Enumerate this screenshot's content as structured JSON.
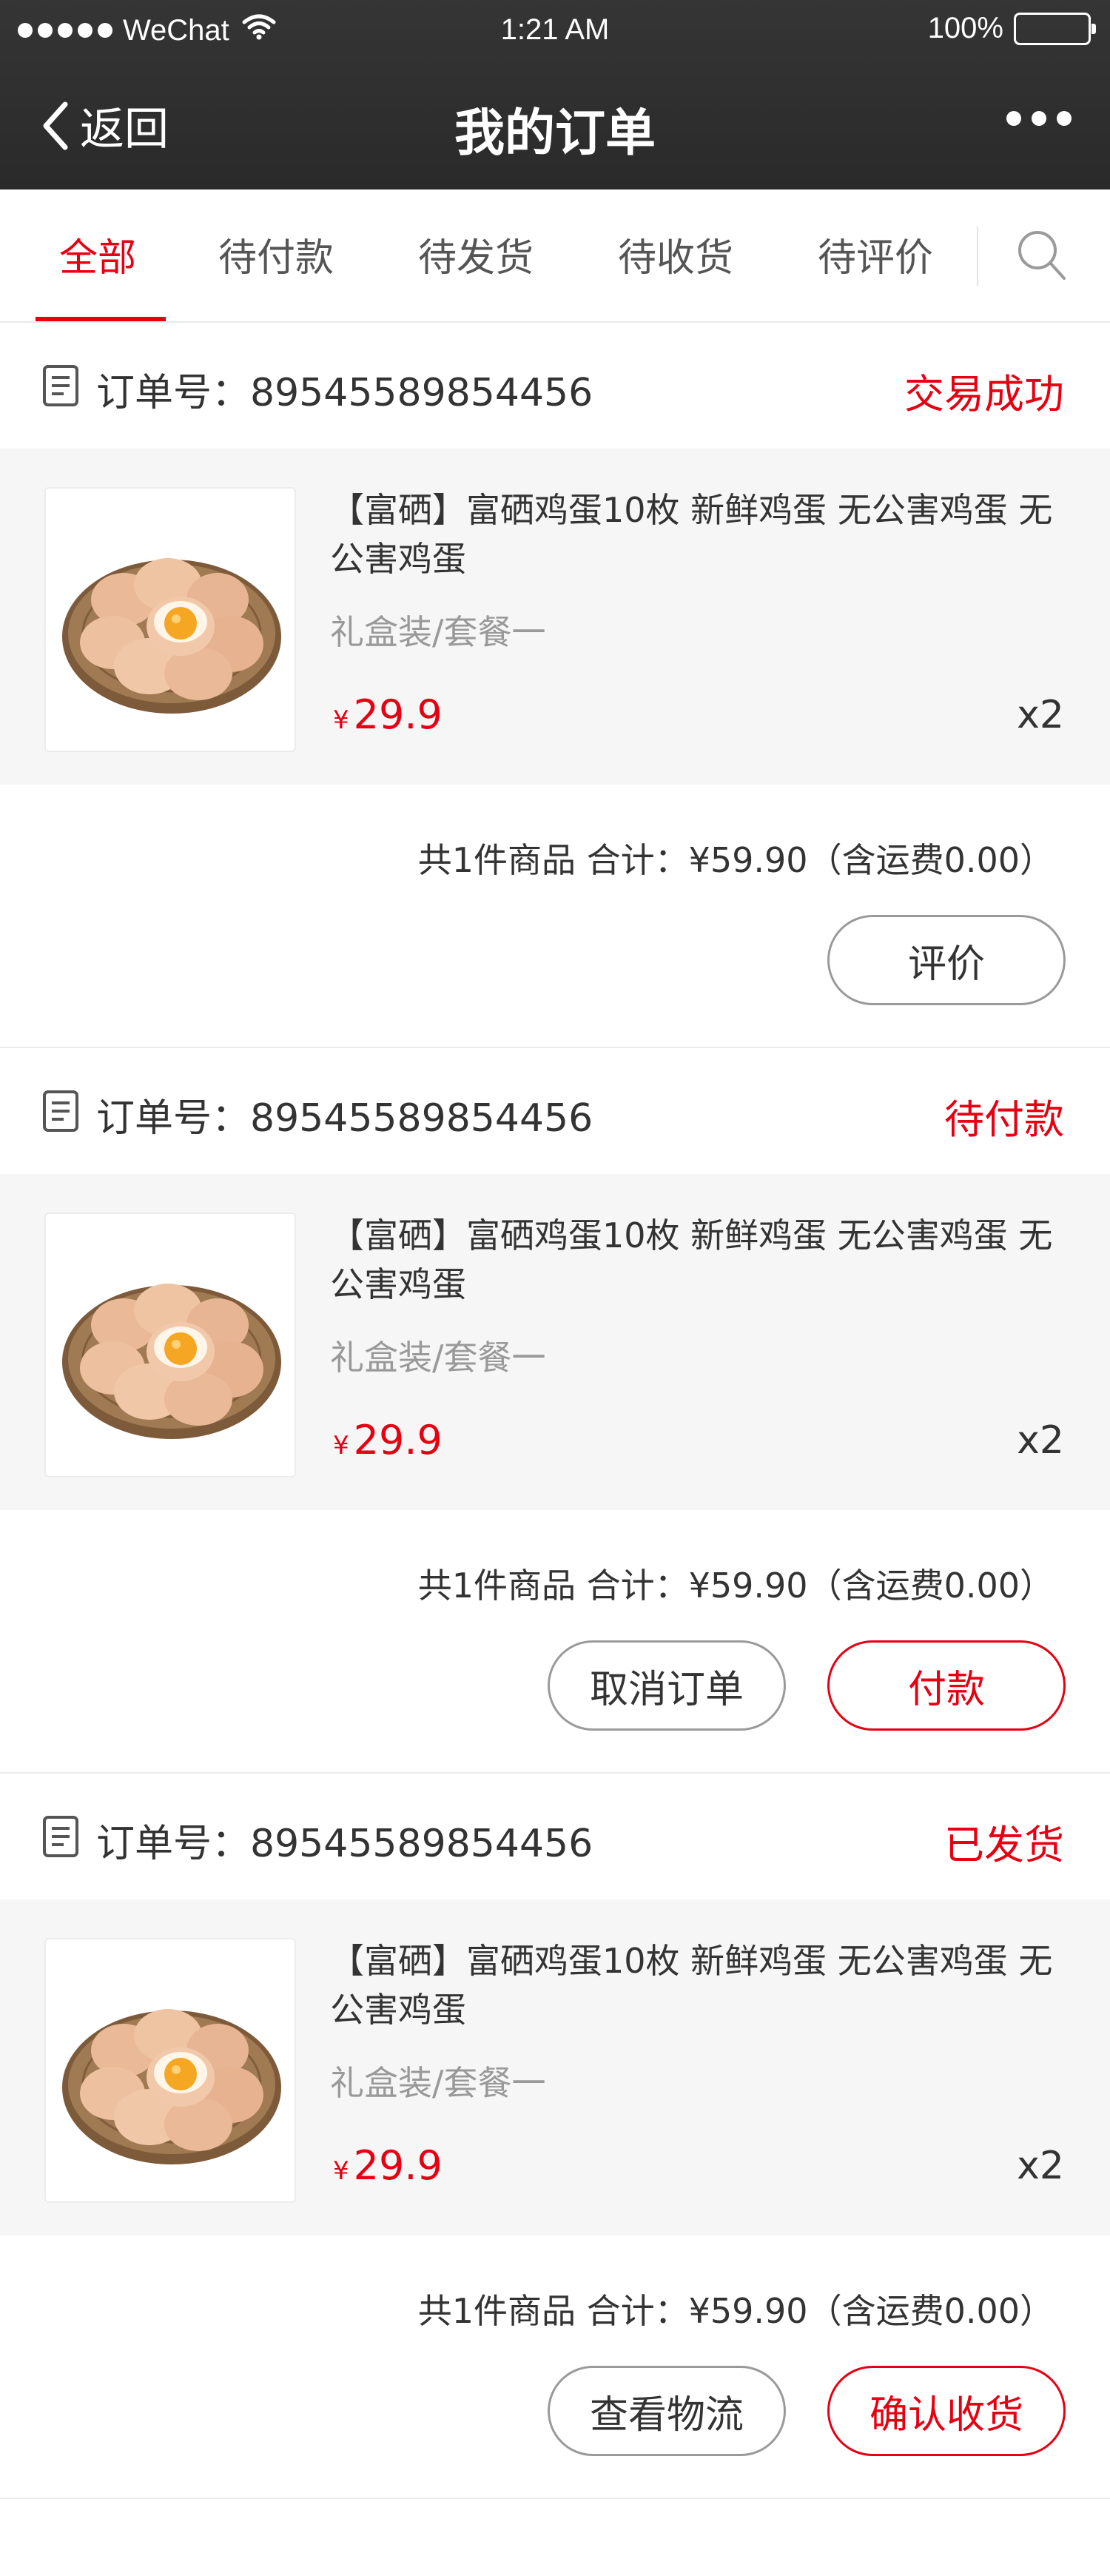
{
  "status_bar": {
    "carrier": "WeChat",
    "time": "1:21 AM",
    "battery": "100%"
  },
  "nav": {
    "back_label": "返回",
    "title": "我的订单"
  },
  "tabs": [
    {
      "label": "全部",
      "active": true
    },
    {
      "label": "待付款",
      "active": false
    },
    {
      "label": "待发货",
      "active": false
    },
    {
      "label": "待收货",
      "active": false
    },
    {
      "label": "待评价",
      "active": false
    }
  ],
  "orders": [
    {
      "order_no_label": "订单号：",
      "order_no": "89545589854456",
      "status": "交易成功",
      "product_name": "【富硒】富硒鸡蛋10枚 新鲜鸡蛋 无公害鸡蛋 无公害鸡蛋",
      "spec": "礼盒装/套餐一",
      "currency": "¥",
      "price": "29.9",
      "qty": "x2",
      "summary": "共1件商品 合计：¥59.90（含运费0.00）",
      "buttons": [
        {
          "label": "评价",
          "style": "grey"
        }
      ]
    },
    {
      "order_no_label": "订单号：",
      "order_no": "89545589854456",
      "status": "待付款",
      "product_name": "【富硒】富硒鸡蛋10枚 新鲜鸡蛋 无公害鸡蛋 无公害鸡蛋",
      "spec": "礼盒装/套餐一",
      "currency": "¥",
      "price": "29.9",
      "qty": "x2",
      "summary": "共1件商品 合计：¥59.90（含运费0.00）",
      "buttons": [
        {
          "label": "取消订单",
          "style": "grey"
        },
        {
          "label": "付款",
          "style": "red"
        }
      ]
    },
    {
      "order_no_label": "订单号：",
      "order_no": "89545589854456",
      "status": "已发货",
      "product_name": "【富硒】富硒鸡蛋10枚 新鲜鸡蛋 无公害鸡蛋 无公害鸡蛋",
      "spec": "礼盒装/套餐一",
      "currency": "¥",
      "price": "29.9",
      "qty": "x2",
      "summary": "共1件商品 合计：¥59.90（含运费0.00）",
      "buttons": [
        {
          "label": "查看物流",
          "style": "grey"
        },
        {
          "label": "确认收货",
          "style": "red"
        }
      ]
    }
  ],
  "colors": {
    "accent": "#e60012",
    "navbar": "#2e2e2e",
    "item_bg": "#f6f6f6",
    "muted_text": "#999999"
  },
  "icons": [
    "back-chevron-icon",
    "more-dots-icon",
    "search-icon",
    "order-doc-icon",
    "wifi-icon",
    "battery-icon"
  ]
}
